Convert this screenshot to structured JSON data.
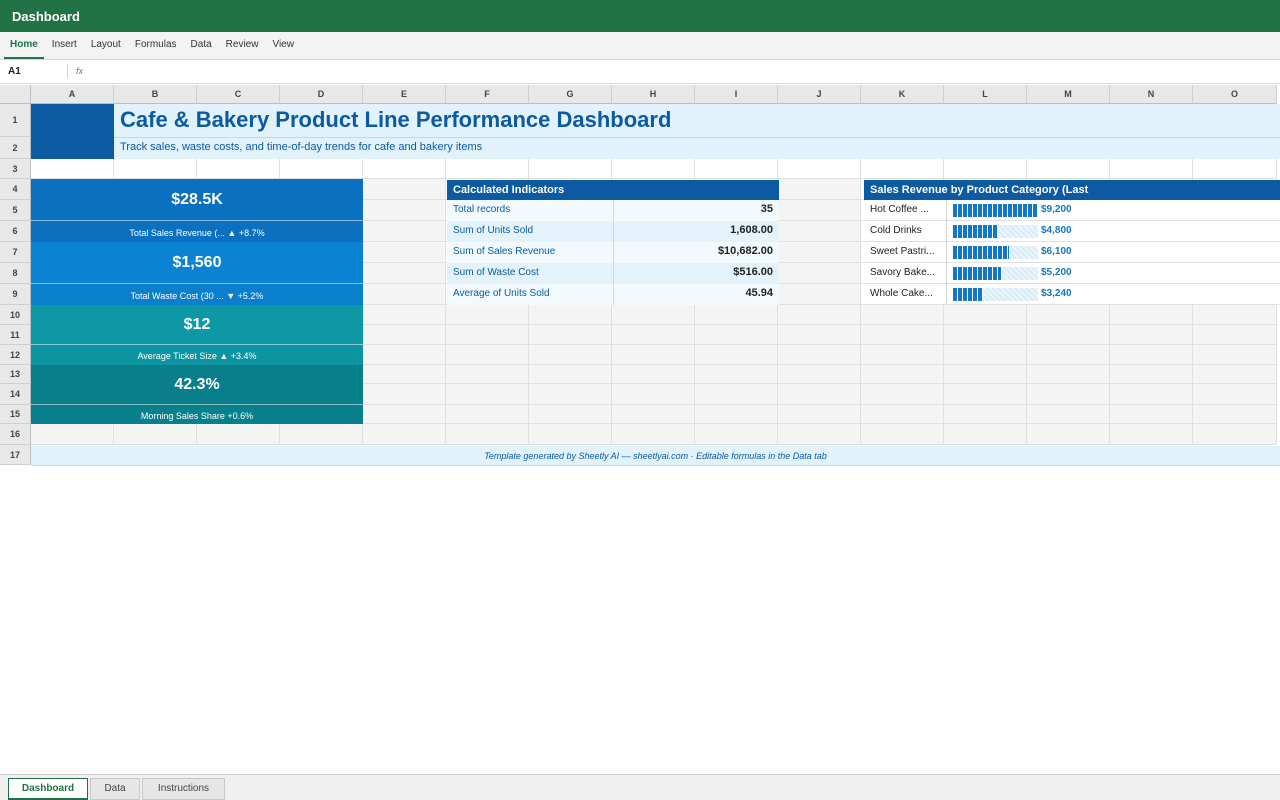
{
  "app": {
    "title": "Dashboard"
  },
  "ribbon": {
    "tabs": [
      "Home",
      "Insert",
      "Layout",
      "Formulas",
      "Data",
      "Review",
      "View"
    ],
    "active": "Home"
  },
  "formula_bar": {
    "name_box": "A1",
    "fx_label": "fx",
    "value": ""
  },
  "grid": {
    "columns": [
      "A",
      "B",
      "C",
      "D",
      "E",
      "F",
      "G",
      "H",
      "I",
      "J",
      "K",
      "L",
      "M",
      "N",
      "O"
    ],
    "rows": [
      "1",
      "2",
      "3",
      "4",
      "5",
      "6",
      "7",
      "8",
      "9",
      "10",
      "11",
      "12",
      "13",
      "14",
      "15",
      "16",
      "17"
    ]
  },
  "dashboard": {
    "title": "Cafe & Bakery Product Line Performance Dashboard",
    "subtitle": "Track sales, waste costs, and time-of-day trends for cafe and bakery items",
    "kpis": [
      {
        "value": "$28.5K",
        "label": "Total Sales Revenue (... ▲ +8.7%",
        "color": "#0a70bf",
        "label_color": "#0a70bf"
      },
      {
        "value": "$1,560",
        "label": "Total Waste Cost (30 ... ▼ +5.2%",
        "color": "#0a83d2",
        "label_color": "#0a7fcb"
      },
      {
        "value": "$12",
        "label": "Average Ticket Size ▲ +3.4%",
        "color": "#0e98a6",
        "label_color": "#0e93a0"
      },
      {
        "value": "42.3%",
        "label": "Morning Sales Share +0.6%",
        "color": "#087f8a",
        "label_color": "#08808b"
      }
    ],
    "indicators": {
      "header": "Calculated Indicators",
      "rows": [
        {
          "label": "Total records",
          "value": "35"
        },
        {
          "label": "Sum of Units Sold",
          "value": "1,608.00"
        },
        {
          "label": "Sum of Sales Revenue",
          "value": "$10,682.00"
        },
        {
          "label": "Sum of Waste Cost",
          "value": "$516.00"
        },
        {
          "label": "Average of Units Sold",
          "value": "45.94"
        }
      ]
    },
    "footer": "Template generated by Sheetly AI — sheetlyai.com · Editable formulas in the Data tab"
  },
  "chart_data": {
    "type": "bar",
    "title": "Sales Revenue by Product Category (Last",
    "categories": [
      "Hot Coffee ...",
      "Cold Drinks",
      "Sweet Pastri...",
      "Savory Bake...",
      "Whole Cake..."
    ],
    "values": [
      9200,
      4800,
      6100,
      5200,
      3240
    ],
    "value_labels": [
      "$9,200",
      "$4,800",
      "$6,100",
      "$5,200",
      "$3,240"
    ],
    "xlim": [
      0,
      9200
    ],
    "orientation": "horizontal",
    "colors": {
      "bar": "#1476c6",
      "track": "#d8ecf8"
    }
  },
  "sheet_tabs": [
    "Dashboard",
    "Data",
    "Instructions"
  ],
  "active_sheet": "Dashboard"
}
